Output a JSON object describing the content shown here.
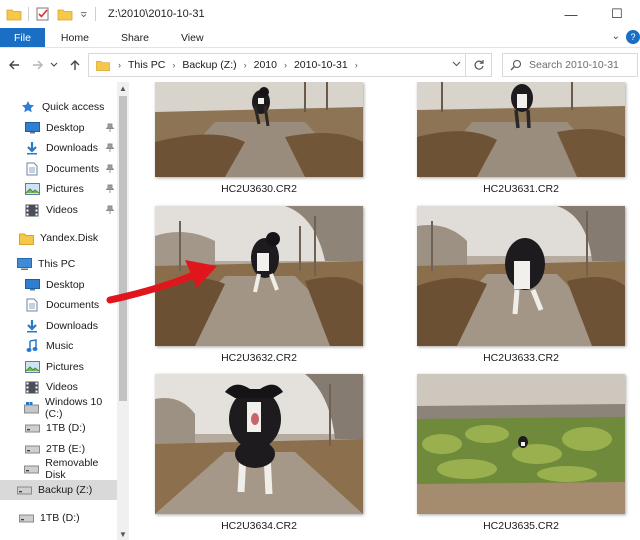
{
  "window": {
    "title": "Z:\\2010\\2010-10-31",
    "minimize_glyph": "—",
    "maximize_glyph": "☐"
  },
  "ribbon": {
    "tabs": [
      "File",
      "Home",
      "Share",
      "View"
    ],
    "expand_glyph": "⌄",
    "help_glyph": "?"
  },
  "address": {
    "crumbs": [
      "This PC",
      "Backup (Z:)",
      "2010",
      "2010-10-31"
    ],
    "separator": "›"
  },
  "search": {
    "placeholder": "Search 2010-10-31"
  },
  "sidebar": {
    "items": [
      {
        "label": "Quick access",
        "icon": "star-icon"
      },
      {
        "label": "Desktop",
        "icon": "desktop-icon",
        "pinned": true
      },
      {
        "label": "Downloads",
        "icon": "download-icon",
        "pinned": true
      },
      {
        "label": "Documents",
        "icon": "documents-icon",
        "pinned": true
      },
      {
        "label": "Pictures",
        "icon": "pictures-icon",
        "pinned": true
      },
      {
        "label": "Videos",
        "icon": "videos-icon",
        "pinned": true
      },
      {
        "label": "Yandex.Disk",
        "icon": "yandex-disk-icon"
      },
      {
        "label": "This PC",
        "icon": "computer-icon"
      },
      {
        "label": "Desktop",
        "icon": "desktop-icon"
      },
      {
        "label": "Documents",
        "icon": "documents-icon"
      },
      {
        "label": "Downloads",
        "icon": "download-icon"
      },
      {
        "label": "Music",
        "icon": "music-icon"
      },
      {
        "label": "Pictures",
        "icon": "pictures-icon"
      },
      {
        "label": "Videos",
        "icon": "videos-icon"
      },
      {
        "label": "Windows 10 (C:)",
        "icon": "windows-drive-icon"
      },
      {
        "label": "1TB (D:)",
        "icon": "drive-icon"
      },
      {
        "label": "2TB (E:)",
        "icon": "drive-icon"
      },
      {
        "label": "Removable Disk",
        "icon": "drive-icon"
      },
      {
        "label": "Backup (Z:)",
        "icon": "drive-icon",
        "selected": true
      },
      {
        "label": "1TB (D:)",
        "icon": "drive-icon"
      }
    ]
  },
  "files": [
    {
      "name": "HC2U3630.CR2"
    },
    {
      "name": "HC2U3631.CR2"
    },
    {
      "name": "HC2U3632.CR2"
    },
    {
      "name": "HC2U3633.CR2"
    },
    {
      "name": "HC2U3634.CR2"
    },
    {
      "name": "HC2U3635.CR2"
    }
  ],
  "colors": {
    "accent": "#1a6fc4",
    "annotation_arrow": "#e0161c",
    "selection": "#d9d9d9"
  }
}
